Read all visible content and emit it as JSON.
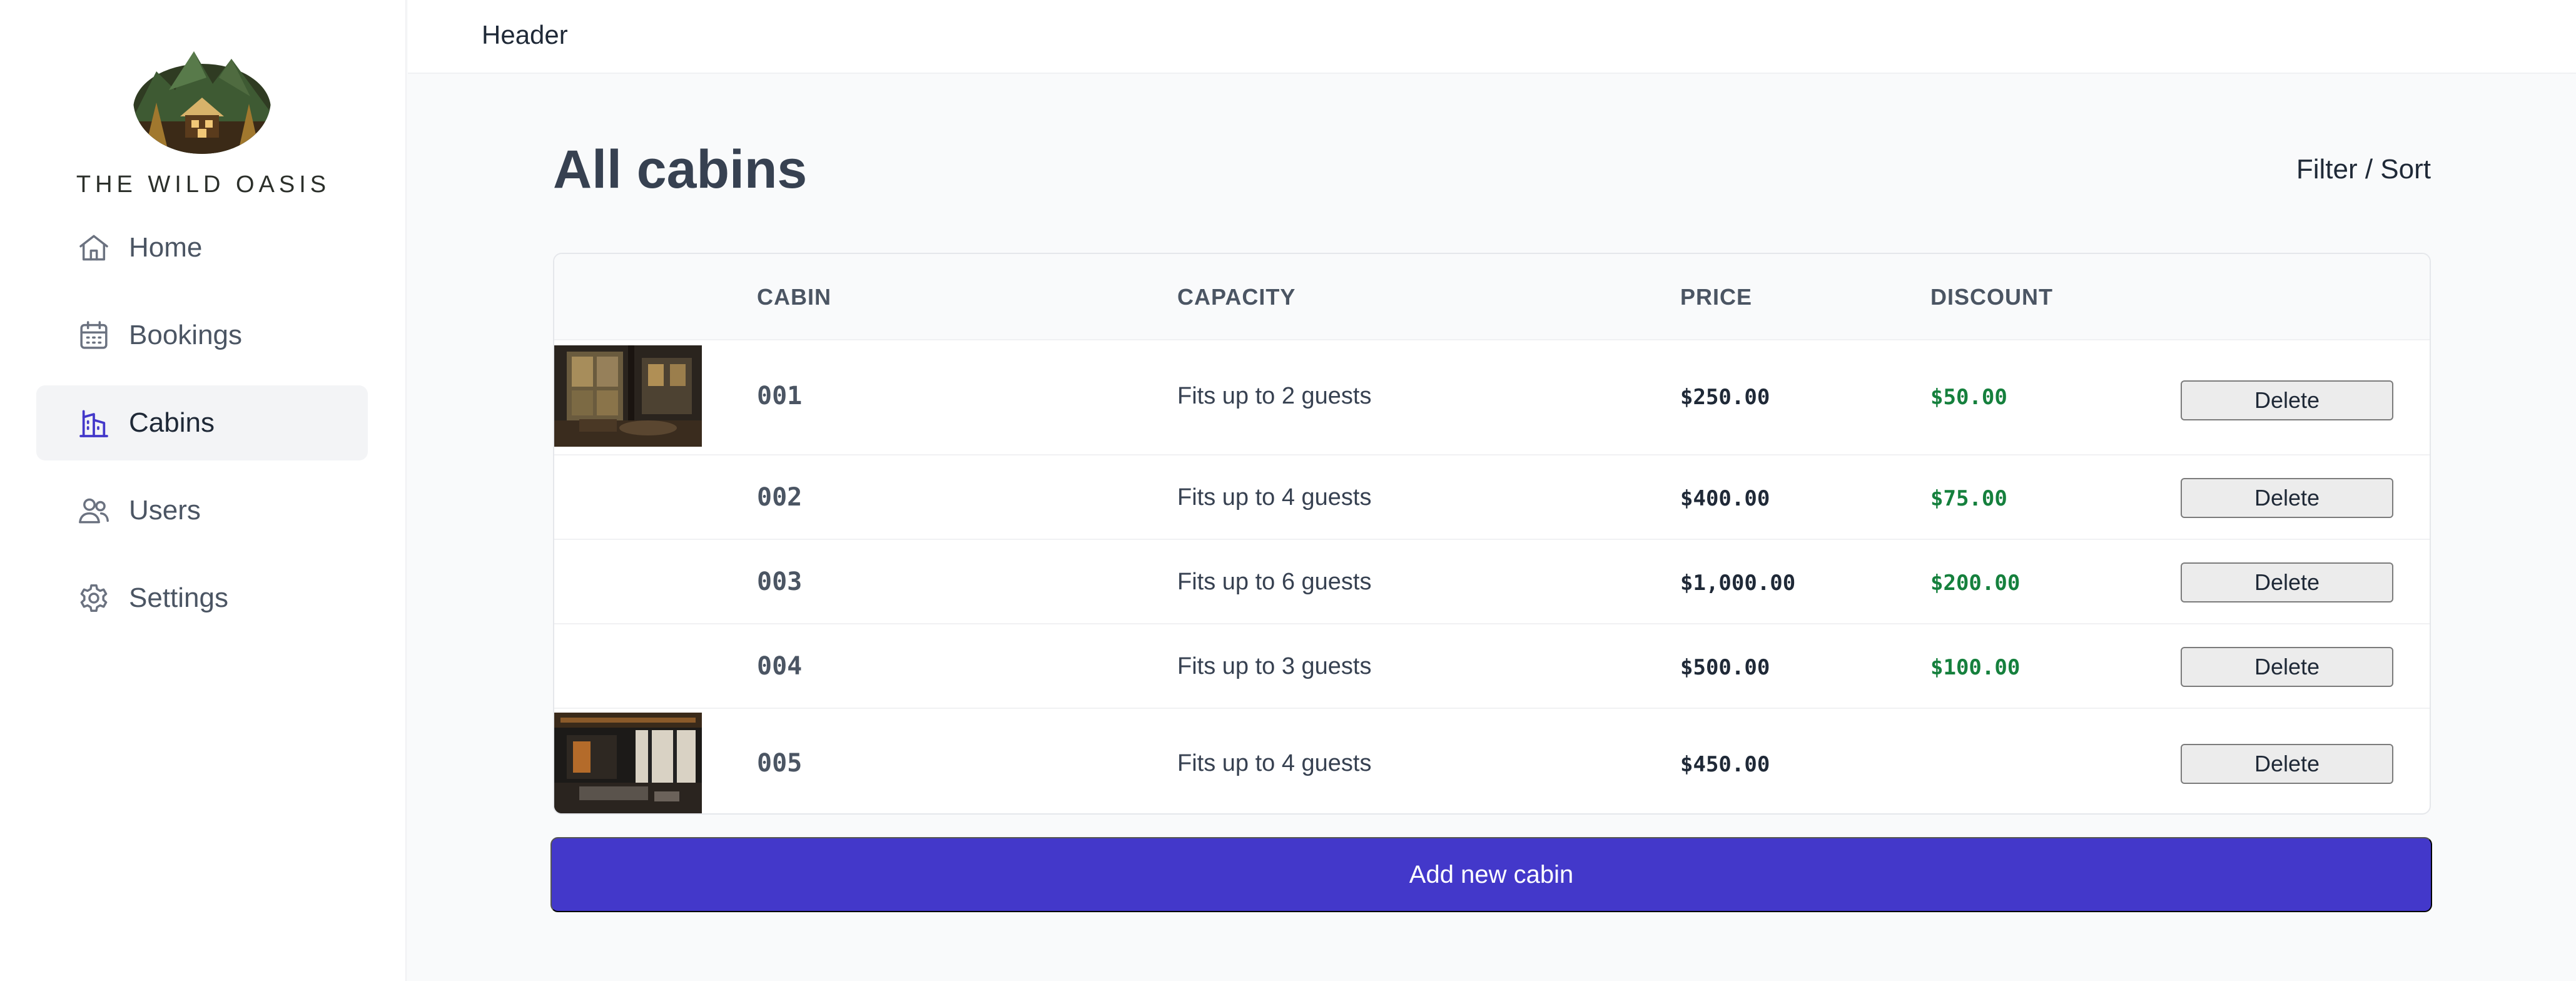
{
  "sidebar": {
    "brand": "THE WILD OASIS",
    "items": [
      {
        "label": "Home",
        "icon": "home-icon",
        "active": false
      },
      {
        "label": "Bookings",
        "icon": "calendar-icon",
        "active": false
      },
      {
        "label": "Cabins",
        "icon": "cabin-icon",
        "active": true
      },
      {
        "label": "Users",
        "icon": "users-icon",
        "active": false
      },
      {
        "label": "Settings",
        "icon": "gear-icon",
        "active": false
      }
    ]
  },
  "header": {
    "title": "Header"
  },
  "main": {
    "title": "All cabins",
    "filter_sort": "Filter / Sort",
    "table": {
      "columns": [
        "CABIN",
        "CAPACITY",
        "PRICE",
        "DISCOUNT"
      ],
      "rows": [
        {
          "name": "001",
          "capacity": "Fits up to 2 guests",
          "price": "$250.00",
          "discount": "$50.00",
          "delete": "Delete"
        },
        {
          "name": "002",
          "capacity": "Fits up to 4 guests",
          "price": "$400.00",
          "discount": "$75.00",
          "delete": "Delete"
        },
        {
          "name": "003",
          "capacity": "Fits up to 6 guests",
          "price": "$1,000.00",
          "discount": "$200.00",
          "delete": "Delete"
        },
        {
          "name": "004",
          "capacity": "Fits up to 3 guests",
          "price": "$500.00",
          "discount": "$100.00",
          "delete": "Delete"
        },
        {
          "name": "005",
          "capacity": "Fits up to 4 guests",
          "price": "$450.00",
          "discount": "",
          "delete": "Delete"
        }
      ]
    },
    "add_button": "Add new cabin"
  },
  "colors": {
    "accent": "#4338ca",
    "active_icon": "#4338ca",
    "discount": "#15803d"
  }
}
